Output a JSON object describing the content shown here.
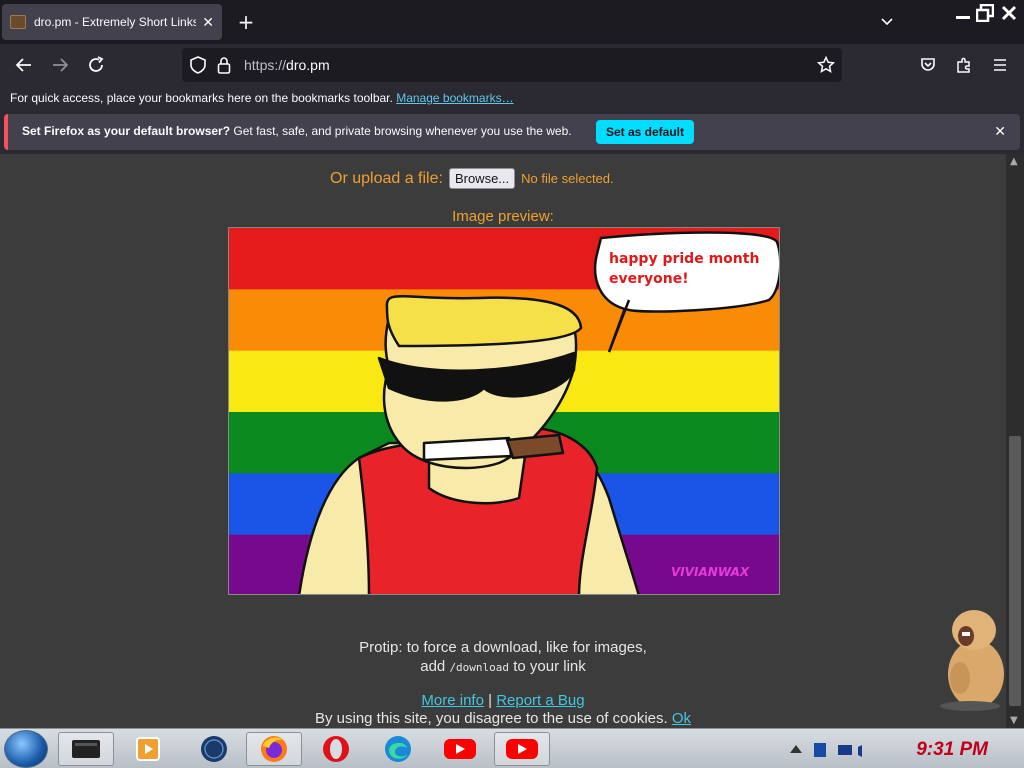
{
  "browser": {
    "tab_title": "dro.pm - Extremely Short Links",
    "tab_close": "✕",
    "new_tab": "+",
    "url_protocol": "https://",
    "url_host": "dro.pm",
    "bookmarks_text": "For quick access, place your bookmarks here on the bookmarks toolbar.",
    "bookmarks_link": "Manage bookmarks…",
    "notification": {
      "bold": "Set Firefox as your default browser?",
      "text": "Get fast, safe, and private browsing whenever you use the web.",
      "button": "Set as default",
      "close": "✕"
    }
  },
  "page": {
    "upload_label": "Or upload a file:",
    "browse_button": "Browse...",
    "no_file": "No file selected.",
    "preview_label": "Image preview:",
    "image": {
      "speech_line1": "happy pride month",
      "speech_line2": "everyone!",
      "signature": "VIVIANWAX",
      "stripe_colors": [
        "#e51a1a",
        "#f98b07",
        "#f9e812",
        "#0a8a1e",
        "#1a55e8",
        "#770a8c"
      ]
    },
    "protip_line1": "Protip: to force a download, like for images,",
    "protip_add": "add ",
    "protip_code": "/download",
    "protip_end": " to your link",
    "more_info": "More info",
    "separator": "|",
    "report_bug": "Report a Bug",
    "cookie_text": "By using this site, you disagree to the use of cookies.",
    "cookie_ok": "Ok"
  },
  "taskbar": {
    "clock": "9:31 PM"
  },
  "colors": {
    "accent_orange": "#f0a030",
    "link_cyan": "#40c8e0",
    "firefox_blue": "#00ddff",
    "clock_red": "#c00018"
  }
}
